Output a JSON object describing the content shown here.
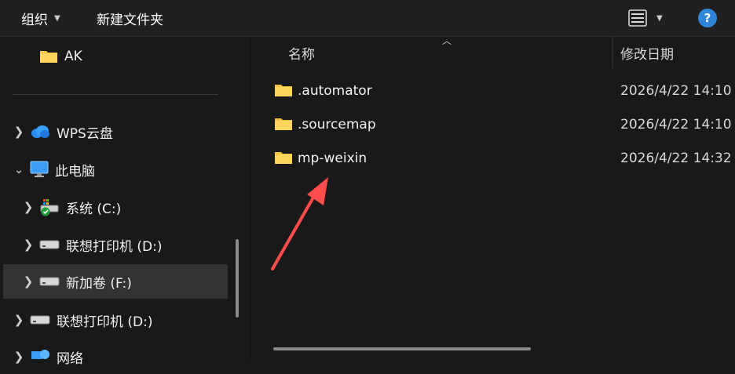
{
  "toolbar": {
    "organize_label": "组织",
    "new_folder_label": "新建文件夹",
    "view_icon": "list-view-icon",
    "help_icon": "help-icon",
    "help_glyph": "?"
  },
  "nav": {
    "items": [
      {
        "label": "AK",
        "icon": "folder-icon",
        "expandable": false
      },
      {
        "label": "WPS云盘",
        "icon": "cloud-icon",
        "expandable": true
      },
      {
        "label": "此电脑",
        "icon": "monitor-icon",
        "expandable": true,
        "expanded": true
      },
      {
        "label": "系统 (C:)",
        "icon": "system-drive-icon",
        "expandable": true
      },
      {
        "label": "联想打印机 (D:)",
        "icon": "drive-icon",
        "expandable": true
      },
      {
        "label": "新加卷 (F:)",
        "icon": "drive-icon",
        "expandable": true,
        "selected": true
      },
      {
        "label": "联想打印机 (D:)",
        "icon": "drive-icon",
        "expandable": true
      },
      {
        "label": "网络",
        "icon": "network-icon",
        "expandable": true
      }
    ]
  },
  "content": {
    "columns": {
      "name": "名称",
      "modified": "修改日期"
    },
    "files": [
      {
        "name": ".automator",
        "modified": "2026/4/22 14:10",
        "icon": "folder-icon"
      },
      {
        "name": ".sourcemap",
        "modified": "2026/4/22 14:10",
        "icon": "folder-icon"
      },
      {
        "name": "mp-weixin",
        "modified": "2026/4/22 14:32",
        "icon": "folder-icon"
      }
    ]
  },
  "colors": {
    "background": "#191919",
    "toolbar": "#202020",
    "selected": "#333333",
    "folder": "#f5c242",
    "accent": "#2f86d9",
    "annotation": "#ff4d4d"
  }
}
